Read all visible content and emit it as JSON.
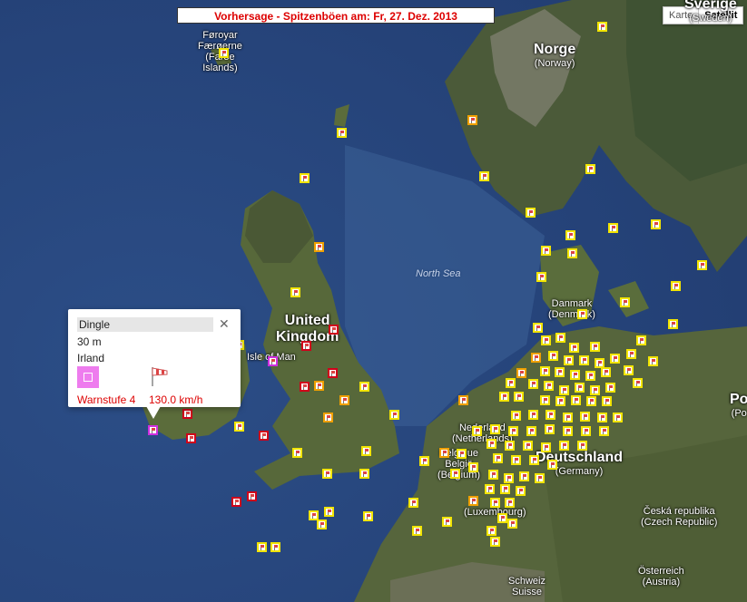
{
  "title": "Vorhersage - Spitzenböen am: Fr, 27. Dez. 2013",
  "map_type": {
    "karte": "Karte",
    "satellit": "Satellit",
    "active": "satellit"
  },
  "labels": [
    {
      "id": "faroe",
      "big": "",
      "sub": "Føroyar\nFærøerne\n(Faroe\nIslands)"
    },
    {
      "id": "norge",
      "big": "Norge",
      "sub": "(Norway)"
    },
    {
      "id": "sverige",
      "big": "Sverige",
      "sub": "(Sweden)"
    },
    {
      "id": "uk",
      "big": "United\nKingdom",
      "sub": ""
    },
    {
      "id": "isleofman",
      "big": "",
      "sub": "Isle of Man"
    },
    {
      "id": "danmark",
      "big": "",
      "sub": "Danmark\n(Denmark)"
    },
    {
      "id": "nederland",
      "big": "",
      "sub": "Nederland\n(Netherlands)"
    },
    {
      "id": "belgie",
      "big": "",
      "sub": "Belgique\nBelgië\n(Belgium)"
    },
    {
      "id": "lux",
      "big": "",
      "sub": "(Luxembourg)"
    },
    {
      "id": "de",
      "big": "Deutschland",
      "sub": "(Germany)"
    },
    {
      "id": "cz",
      "big": "",
      "sub": "Česká republika\n(Czech Republic)"
    },
    {
      "id": "schweiz",
      "big": "",
      "sub": "Schweiz\nSuisse"
    },
    {
      "id": "oe",
      "big": "",
      "sub": "Österreich\n(Austria)"
    },
    {
      "id": "po",
      "big": "Po",
      "sub": "(Po"
    }
  ],
  "sea_label": "North Sea",
  "popup": {
    "name": "Dingle",
    "altitude": "30 m",
    "country": "Irland",
    "level_color": "#ee7cee",
    "warning": "Warnstufe 4",
    "speed": "130.0  km/h",
    "icons": [
      "close-icon",
      "windsock-icon"
    ]
  },
  "marker_colors": {
    "y": "#f2e400",
    "o": "#f0a000",
    "r": "#d0001a",
    "m": "#d030e0"
  }
}
